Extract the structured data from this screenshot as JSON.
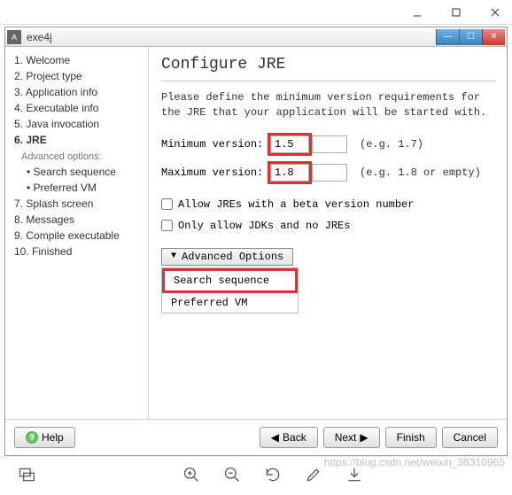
{
  "outer_title": "",
  "app_title": "exe4j",
  "brand": "exe4j",
  "sidebar": {
    "steps": [
      {
        "n": "1.",
        "label": "Welcome"
      },
      {
        "n": "2.",
        "label": "Project type"
      },
      {
        "n": "3.",
        "label": "Application info"
      },
      {
        "n": "4.",
        "label": "Executable info"
      },
      {
        "n": "5.",
        "label": "Java invocation"
      },
      {
        "n": "6.",
        "label": "JRE"
      },
      {
        "n": "7.",
        "label": "Splash screen"
      },
      {
        "n": "8.",
        "label": "Messages"
      },
      {
        "n": "9.",
        "label": "Compile executable"
      },
      {
        "n": "10.",
        "label": "Finished"
      }
    ],
    "advanced_header": "Advanced options:",
    "substeps": [
      "Search sequence",
      "Preferred VM"
    ]
  },
  "main": {
    "title": "Configure JRE",
    "desc": "Please define the minimum version requirements for the JRE that your application will be started with.",
    "min_label": "Minimum version:",
    "max_label": "Maximum version:",
    "min_value": "1.5",
    "max_value": "1.8",
    "min_hint": "(e.g. 1.7)",
    "max_hint": "(e.g. 1.8 or empty)",
    "chk_beta": "Allow JREs with a beta version number",
    "chk_jdk": "Only allow JDKs and no JREs",
    "adv_toggle": "Advanced Options",
    "adv_items": [
      "Search sequence",
      "Preferred VM"
    ]
  },
  "footer": {
    "help": "Help",
    "back": "Back",
    "next": "Next",
    "finish": "Finish",
    "cancel": "Cancel"
  },
  "watermark": "https://blog.csdn.net/weixin_38310965"
}
